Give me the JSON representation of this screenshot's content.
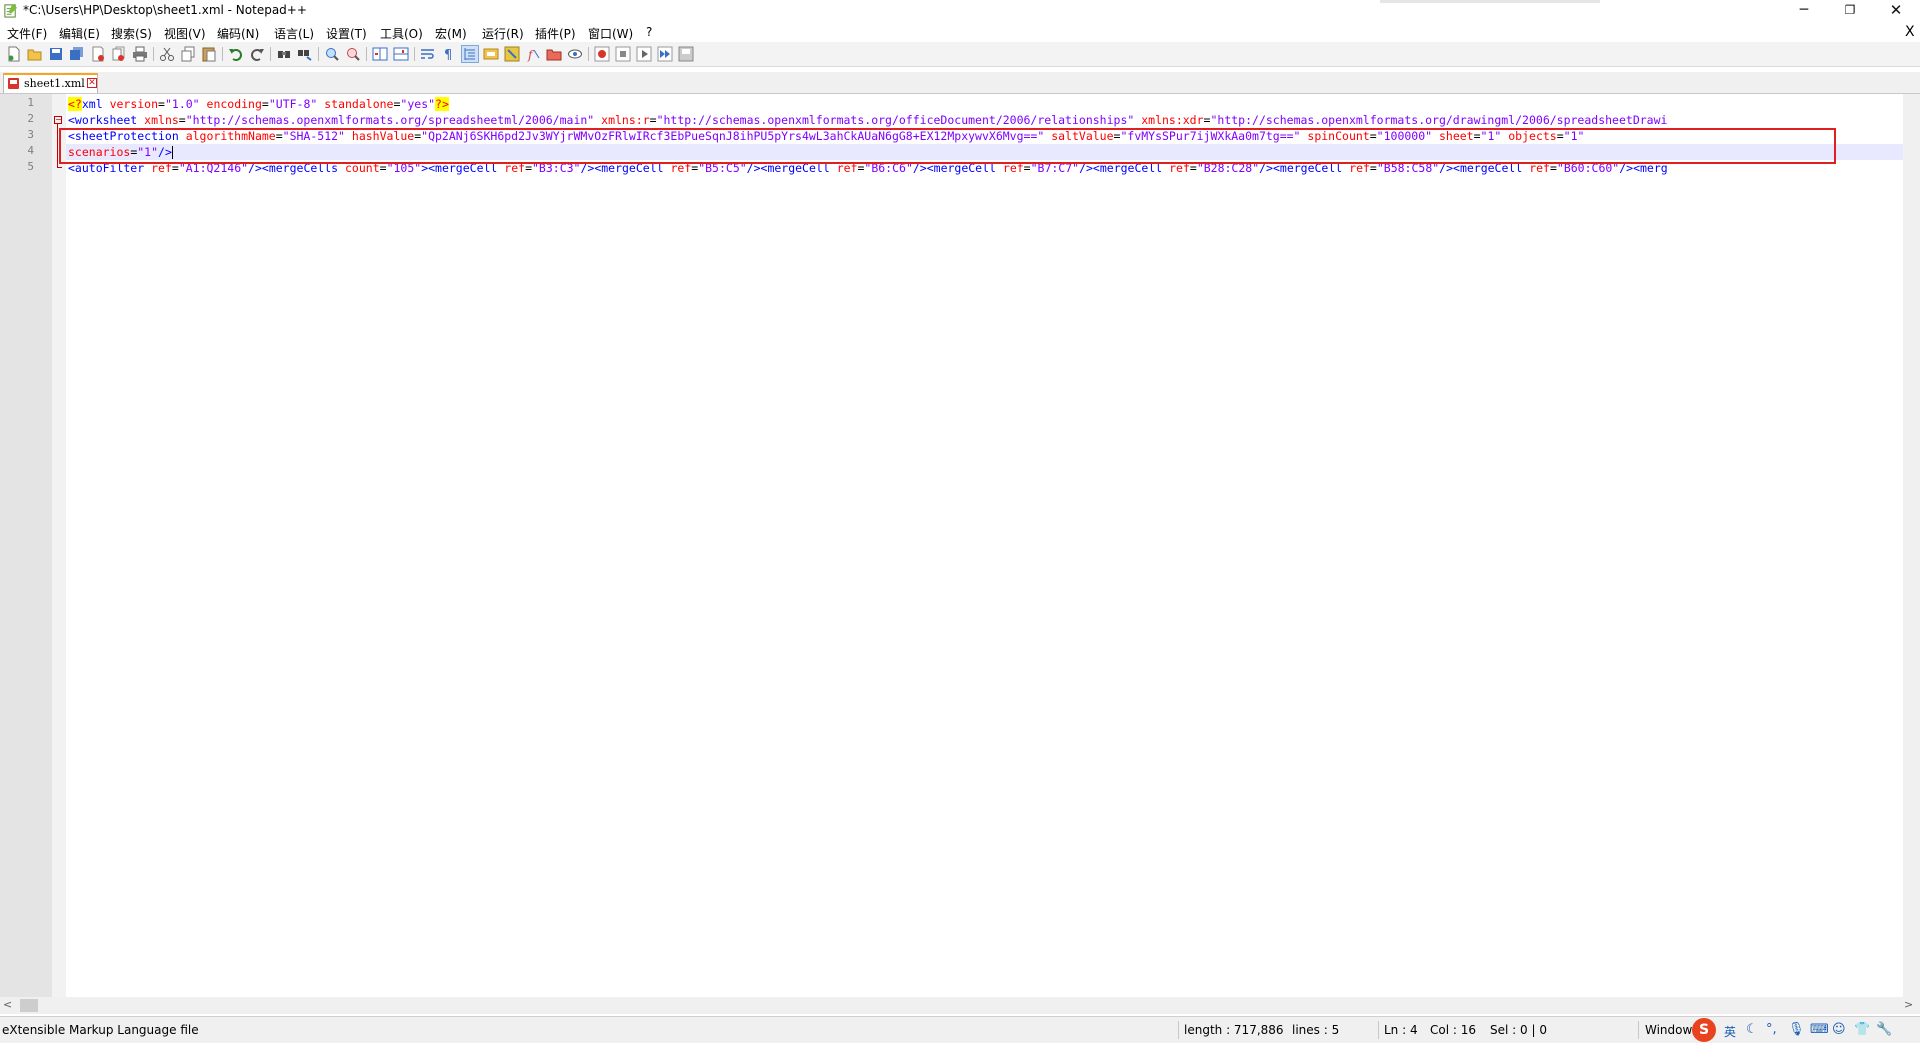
{
  "window": {
    "title": "*C:\\Users\\HP\\Desktop\\sheet1.xml - Notepad++",
    "minimize_glyph": "─",
    "maximize_glyph": "❐",
    "close_glyph": "✕"
  },
  "menu": {
    "items": [
      "文件(F)",
      "编辑(E)",
      "搜索(S)",
      "视图(V)",
      "编码(N)",
      "语言(L)",
      "设置(T)",
      "工具(O)",
      "宏(M)",
      "运行(R)",
      "插件(P)",
      "窗口(W)",
      "?"
    ],
    "close_glyph": "X"
  },
  "tab": {
    "label": "sheet1.xml",
    "close_glyph": "✕"
  },
  "editor": {
    "line_numbers": [
      "1",
      "2",
      "3",
      "4",
      "5"
    ],
    "line1": {
      "pi_open": "<?",
      "name": "xml",
      "a1": " version",
      "eq1": "=",
      "v1": "\"1.0\"",
      "a2": " encoding",
      "eq2": "=",
      "v2": "\"UTF-8\"",
      "a3": " standalone",
      "eq3": "=",
      "v3": "\"yes\"",
      "pi_close": "?>"
    },
    "line2": {
      "tag": "<worksheet",
      "a1": " xmlns",
      "eq1": "=",
      "v1": "\"http://schemas.openxmlformats.org/spreadsheetml/2006/main\"",
      "a2": " xmlns:r",
      "eq2": "=",
      "v2": "\"http://schemas.openxmlformats.org/officeDocument/2006/relationships\"",
      "a3": " xmlns:xdr",
      "eq3": "=",
      "v3": "\"http://schemas.openxmlformats.org/drawingml/2006/spreadsheetDrawi"
    },
    "line3": {
      "tag": "<sheetProtection",
      "a1": " algorithmName",
      "eq1": "=",
      "v1": "\"SHA-512\"",
      "a2": " hashValue",
      "eq2": "=",
      "v2": "\"Qp2ANj6SKH6pd2Jv3WYjrWMvOzFRlwIRcf3EbPueSqnJ8ihPU5pYrs4wL3ahCkAUaN6gG8+EX12MpxywvX6Mvg==\"",
      "a3": " saltValue",
      "eq3": "=",
      "v3": "\"fvMYsSPur7ijWXkAa0m7tg==\"",
      "a4": " spinCount",
      "eq4": "=",
      "v4": "\"100000\"",
      "a5": " sheet",
      "eq5": "=",
      "v5": "\"1\"",
      "a6": " objects",
      "eq6": "=",
      "v6": "\"1\""
    },
    "line4": {
      "a1": "scenarios",
      "eq1": "=",
      "v1": "\"1\"",
      "tag_close": "/>"
    },
    "line5": {
      "tag1": "<autoFilter",
      "a1": " ref",
      "eq1": "=",
      "v1": "\"A1:Q2146\"",
      "c1": "/><mergeCells",
      "a2": " count",
      "eq2": "=",
      "v2": "\"105\"",
      "c2": "><mergeCell",
      "a3": " ref",
      "eq3": "=",
      "v3": "\"B3:C3\"",
      "c3": "/><mergeCell",
      "a4": " ref",
      "eq4": "=",
      "v4": "\"B5:C5\"",
      "c4": "/><mergeCell",
      "a5": " ref",
      "eq5": "=",
      "v5": "\"B6:C6\"",
      "c5": "/><mergeCell",
      "a6": " ref",
      "eq6": "=",
      "v6": "\"B7:C7\"",
      "c6": "/><mergeCell",
      "a7": " ref",
      "eq7": "=",
      "v7": "\"B28:C28\"",
      "c7": "/><mergeCell",
      "a8": " ref",
      "eq8": "=",
      "v8": "\"B58:C58\"",
      "c8": "/><mergeCell",
      "a9": " ref",
      "eq9": "=",
      "v9": "\"B60:C60\"",
      "c9": "/><merg"
    }
  },
  "scrollbar": {
    "left_arrow": "<",
    "right_arrow": ">"
  },
  "status": {
    "file_type": "eXtensible Markup Language file",
    "length": "length : 717,886",
    "lines": "lines : 5",
    "ln": "Ln : 4",
    "col": "Col : 16",
    "sel": "Sel : 0 | 0",
    "eol": "Windows",
    "ime_logo": "S",
    "ime_lang": "英"
  },
  "colors": {
    "tag": "#0000ff",
    "attribute": "#ff0000",
    "value": "#8000ff",
    "pi_background": "#ffff00",
    "highlight_box": "#e02020",
    "current_line": "#e8e8ff"
  }
}
